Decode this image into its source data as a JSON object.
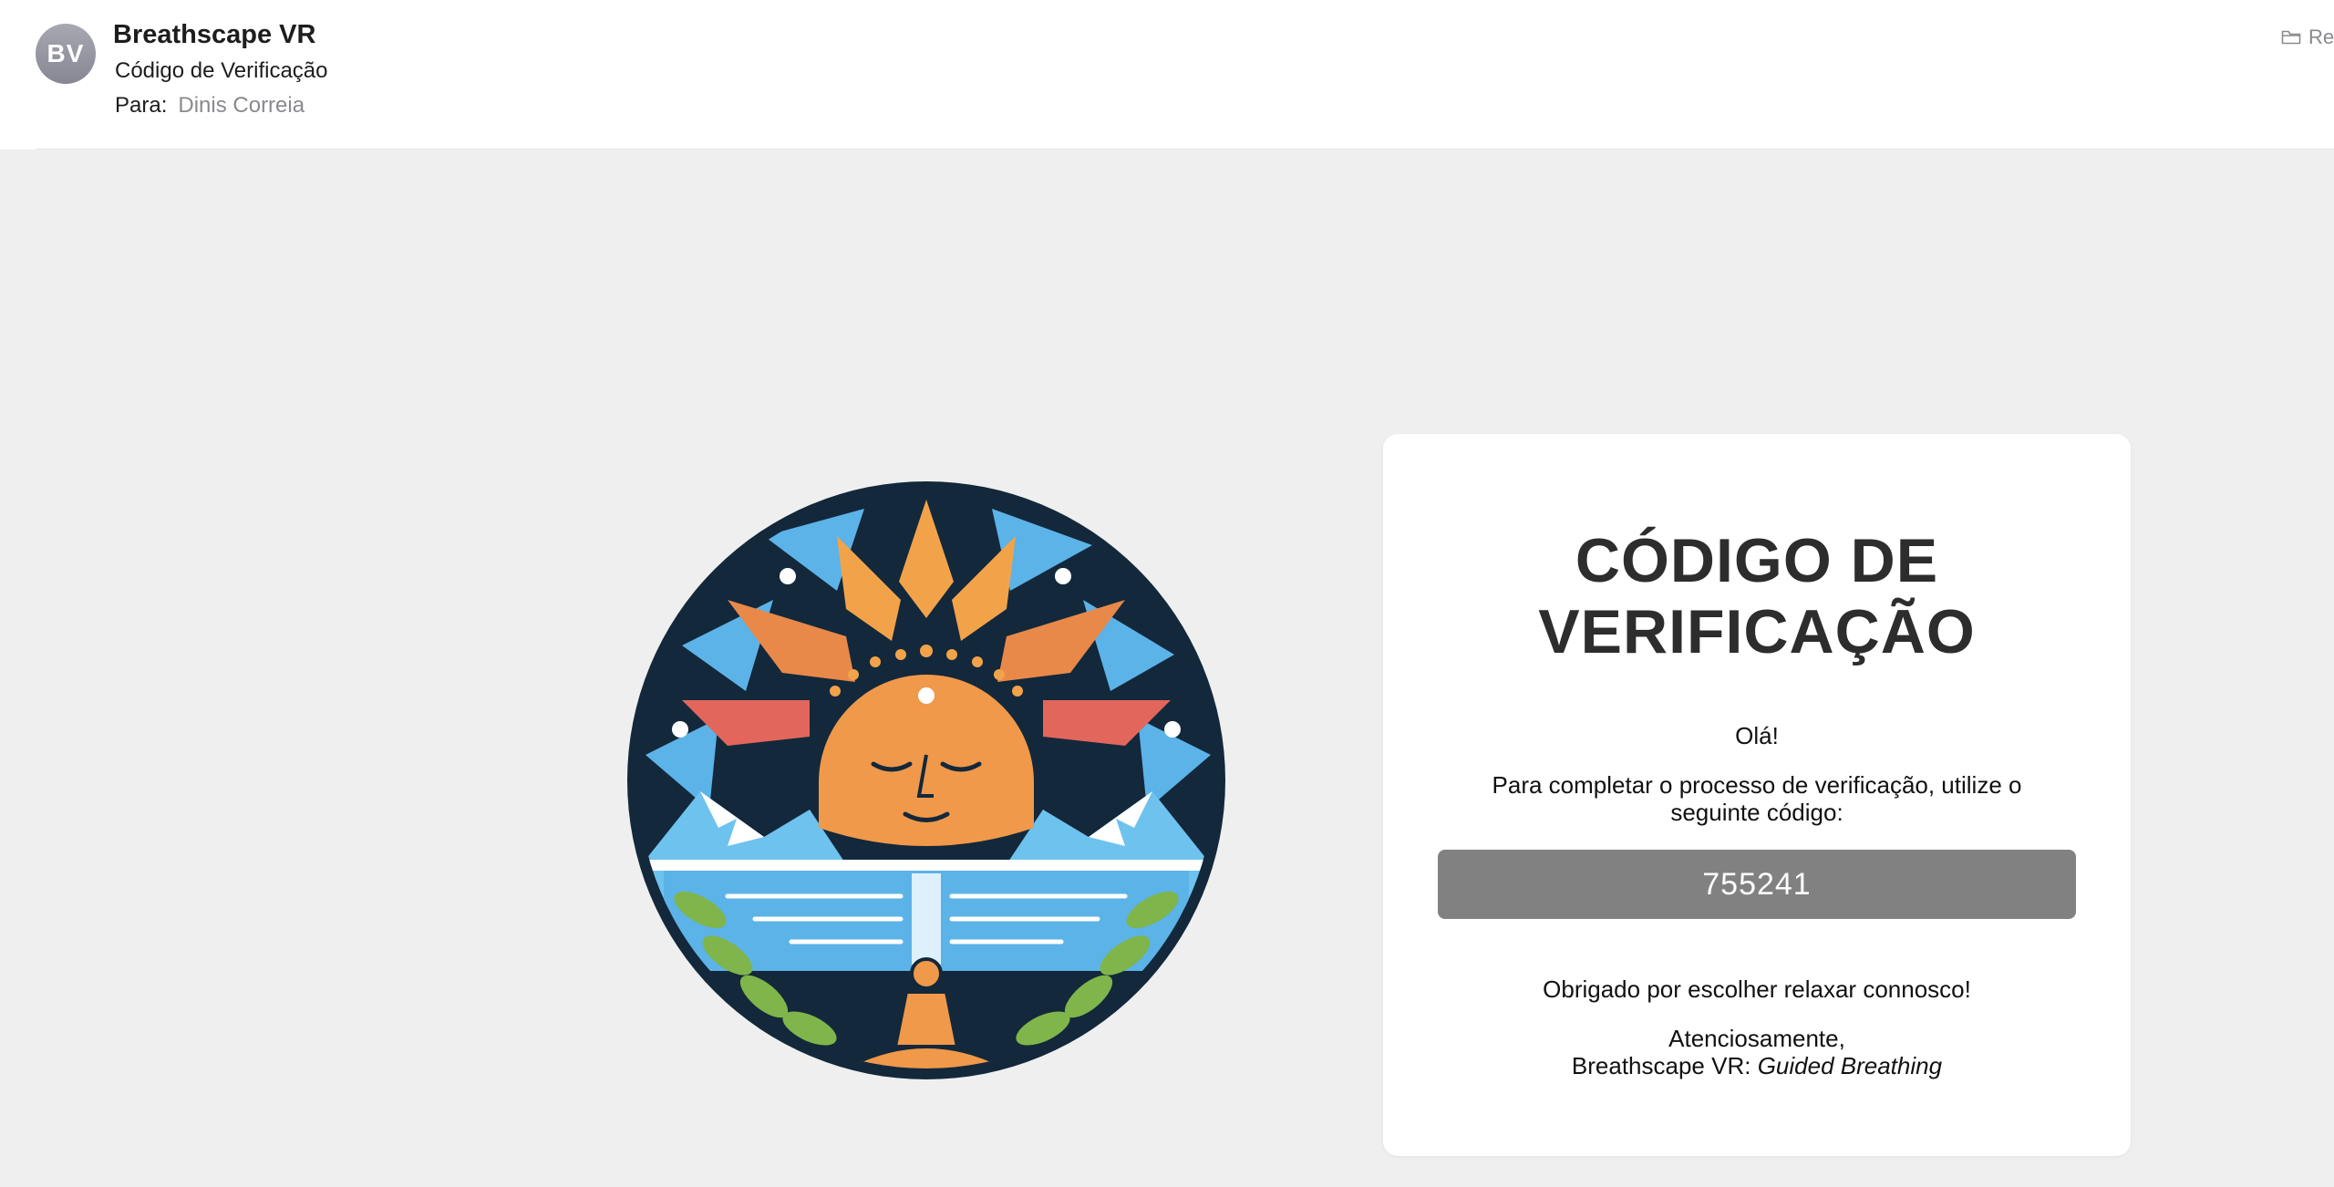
{
  "header": {
    "avatar_initials": "BV",
    "sender": "Breathscape VR",
    "subject": "Código de Verificação",
    "to_label": "Para:",
    "to_name": "Dinis Correia",
    "folder_label": "Re",
    "folder_icon": "folder-icon"
  },
  "email": {
    "logo_icon": "meditation-sun-logo",
    "title_line1": "CÓDIGO DE",
    "title_line2": "VERIFICAÇÃO",
    "greeting": "Olá!",
    "instructions": "Para completar o processo de verificação, utilize o seguinte código:",
    "code": "755241",
    "thanks": "Obrigado por escolher relaxar connosco!",
    "signoff": "Atenciosamente,",
    "signature_prefix": "Breathscape VR:",
    "signature_tagline": "Guided Breathing"
  },
  "colors": {
    "avatar": "#8f909b",
    "background": "#efefef",
    "code_box": "#818181",
    "title": "#2d2d2d"
  }
}
